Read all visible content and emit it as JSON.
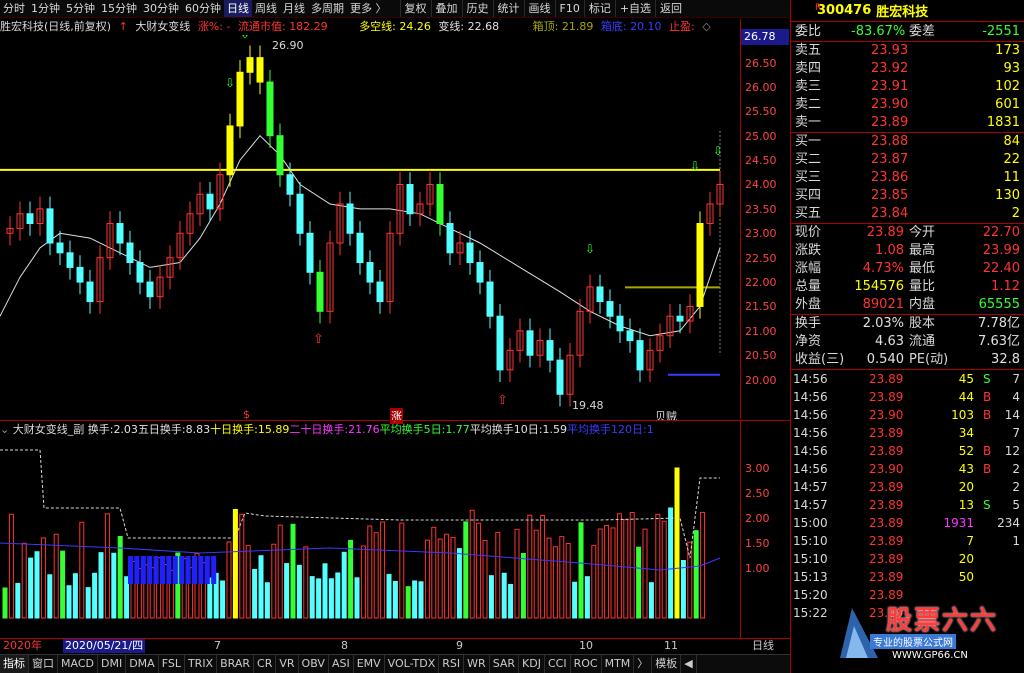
{
  "toolbar": {
    "periods": [
      "分时",
      "1分钟",
      "5分钟",
      "15分钟",
      "30分钟",
      "60分钟",
      "日线",
      "周线",
      "月线",
      "多周期",
      "更多 〉"
    ],
    "active_period": "日线",
    "tools": [
      "复权",
      "叠加",
      "历史",
      "统计",
      "画线",
      "F10",
      "标记",
      "+自选",
      "返回"
    ]
  },
  "main_info": {
    "stock_title": "胜宏科技(日线,前复权)",
    "indicator_name": "大财女变线",
    "indicator_suffix": "涨%:",
    "indicator_value": "-",
    "float_cap_label": "流通市值:",
    "float_cap_value": "182.29",
    "bullbear_label": "多空线:",
    "bullbear_value": "24.26",
    "change_label": "变线:",
    "change_value": "22.68",
    "box_top_label": "箱顶:",
    "box_top_value": "21.89",
    "box_bottom_label": "箱底:",
    "box_bottom_value": "20.10",
    "stop_label": "止盈:"
  },
  "main_axis": {
    "ticks": [
      "26.50",
      "26.00",
      "25.50",
      "25.00",
      "24.50",
      "24.00",
      "23.50",
      "23.00",
      "22.50",
      "22.00",
      "21.50",
      "21.00",
      "20.50",
      "20.00"
    ],
    "current_price_label": "26.78",
    "high_marker": "26.90",
    "low_marker": "19.48",
    "bottom_labels": [
      "$",
      "涨",
      "贝贼"
    ]
  },
  "sub_info": {
    "name": "大财女变线_副",
    "items": [
      {
        "label": "换手:",
        "value": "2.03"
      },
      {
        "label": "五日换手:",
        "value": "8.83"
      },
      {
        "label": "十日换手:",
        "value": "15.89"
      },
      {
        "label": "二十日换手:",
        "value": "21.76"
      },
      {
        "label": "平均换手5日:",
        "value": "1.77"
      },
      {
        "label": "平均换手10日:",
        "value": "1.59"
      },
      {
        "label": "平均换手120日:",
        "value": "1"
      }
    ]
  },
  "sub_axis": {
    "ticks": [
      "3.00",
      "2.50",
      "2.00",
      "1.50",
      "1.00"
    ]
  },
  "date_axis": {
    "labels": [
      "2020年",
      "2020/05/21/四",
      "7",
      "8",
      "9",
      "10",
      "11"
    ],
    "period_label": "日线"
  },
  "bottom_tabs": [
    "指标",
    "窗口",
    "MACD",
    "DMI",
    "DMA",
    "FSL",
    "TRIX",
    "BRAR",
    "CR",
    "VR",
    "OBV",
    "ASI",
    "EMV",
    "VOL-TDX",
    "RSI",
    "WR",
    "SAR",
    "KDJ",
    "CCI",
    "ROC",
    "MTM",
    "〉",
    "模板",
    "◀"
  ],
  "quote": {
    "code": "300476",
    "name": "胜宏科技",
    "r_tag": "R",
    "weibi_label": "委比",
    "weibi_value": "-83.67%",
    "weicha_label": "委差",
    "weicha_value": "-2551",
    "asks": [
      {
        "label": "卖五",
        "price": "23.93",
        "vol": "173"
      },
      {
        "label": "卖四",
        "price": "23.92",
        "vol": "93"
      },
      {
        "label": "卖三",
        "price": "23.91",
        "vol": "102"
      },
      {
        "label": "卖二",
        "price": "23.90",
        "vol": "601"
      },
      {
        "label": "卖一",
        "price": "23.89",
        "vol": "1831"
      }
    ],
    "bids": [
      {
        "label": "买一",
        "price": "23.88",
        "vol": "84"
      },
      {
        "label": "买二",
        "price": "23.87",
        "vol": "22"
      },
      {
        "label": "买三",
        "price": "23.86",
        "vol": "11"
      },
      {
        "label": "买四",
        "price": "23.85",
        "vol": "130"
      },
      {
        "label": "买五",
        "price": "23.84",
        "vol": "2"
      }
    ],
    "stats": [
      {
        "l1": "现价",
        "v1": "23.89",
        "l2": "今开",
        "v2": "22.70"
      },
      {
        "l1": "涨跌",
        "v1": "1.08",
        "l2": "最高",
        "v2": "23.99"
      },
      {
        "l1": "涨幅",
        "v1": "4.73%",
        "l2": "最低",
        "v2": "22.40"
      },
      {
        "l1": "总量",
        "v1": "154576",
        "l2": "量比",
        "v2": "1.12"
      },
      {
        "l1": "外盘",
        "v1": "89021",
        "l2": "内盘",
        "v2": "65555"
      }
    ],
    "stats2": [
      {
        "l1": "换手",
        "v1": "2.03%",
        "l2": "股本",
        "v2": "7.78亿"
      },
      {
        "l1": "净资",
        "v1": "4.63",
        "l2": "流通",
        "v2": "7.63亿"
      },
      {
        "l1": "收益(三)",
        "v1": "0.540",
        "l2": "PE(动)",
        "v2": "32.8"
      }
    ],
    "ticks": [
      {
        "time": "14:56",
        "price": "23.89",
        "vol": "45",
        "side": "S",
        "n": "7"
      },
      {
        "time": "14:56",
        "price": "23.89",
        "vol": "44",
        "side": "B",
        "n": "4"
      },
      {
        "time": "14:56",
        "price": "23.90",
        "vol": "103",
        "side": "B",
        "n": "14"
      },
      {
        "time": "14:56",
        "price": "23.89",
        "vol": "34",
        "side": "",
        "n": "7"
      },
      {
        "time": "14:56",
        "price": "23.89",
        "vol": "52",
        "side": "B",
        "n": "12"
      },
      {
        "time": "14:56",
        "price": "23.90",
        "vol": "43",
        "side": "B",
        "n": "2"
      },
      {
        "time": "14:57",
        "price": "23.89",
        "vol": "20",
        "side": "",
        "n": "2"
      },
      {
        "time": "14:57",
        "price": "23.89",
        "vol": "13",
        "side": "S",
        "n": "5"
      },
      {
        "time": "15:00",
        "price": "23.89",
        "vol": "1931",
        "side": "",
        "n": "234"
      },
      {
        "time": "15:10",
        "price": "23.89",
        "vol": "7",
        "side": "",
        "n": "1"
      },
      {
        "time": "15:10",
        "price": "23.89",
        "vol": "20",
        "side": "",
        "n": ""
      },
      {
        "time": "15:13",
        "price": "23.89",
        "vol": "50",
        "side": "",
        "n": ""
      },
      {
        "time": "15:20",
        "price": "23.89",
        "vol": "",
        "side": "",
        "n": ""
      },
      {
        "time": "15:22",
        "price": "23.89",
        "vol": "",
        "side": "",
        "n": ""
      }
    ],
    "watermark": "股票六六",
    "watermark_sub": "专业的股票公式网",
    "watermark_url": "WWW.GP66.CN"
  },
  "colors": {
    "up": "#ff3333",
    "down": "#54ffff",
    "green": "#33ff33",
    "yellow": "#ffff00",
    "axis": "#aa0000"
  }
}
